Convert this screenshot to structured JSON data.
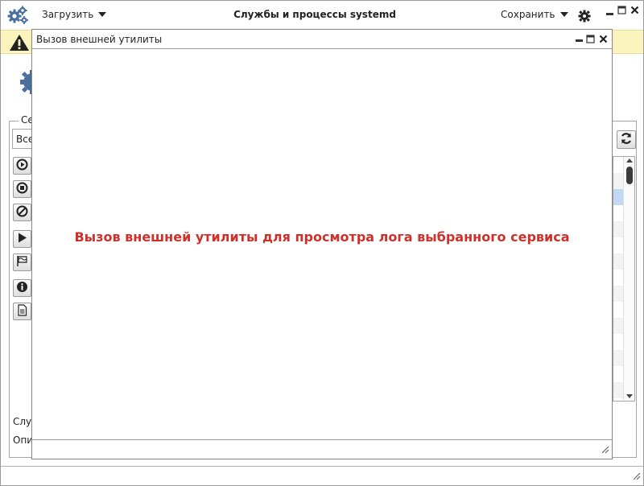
{
  "app": {
    "title": "Службы и процессы systemd",
    "load_menu": "Загрузить",
    "save_menu": "Сохранить"
  },
  "services_panel": {
    "group_caption": "Се",
    "filter_value": "Все",
    "service_label": "Слу",
    "description_label": "Опи"
  },
  "dialog": {
    "title": "Вызов внешней утилиты",
    "message": "Вызов внешней утилиты для просмотра лога выбранного сервиса",
    "message_color": "#d0302a"
  },
  "colors": {
    "warning_bar": "#fbf4bd",
    "accent": "#4a6f9e",
    "selected_row": "#c4d8f4"
  },
  "icons": {
    "app": "gears-icon",
    "warning": "warning-triangle-icon",
    "settings": "gear-icon",
    "side_buttons": [
      "play-circle-icon",
      "stop-circle-icon",
      "block-icon",
      "play-icon",
      "flag-icon",
      "info-icon",
      "document-icon"
    ],
    "refresh": "refresh-icon"
  }
}
